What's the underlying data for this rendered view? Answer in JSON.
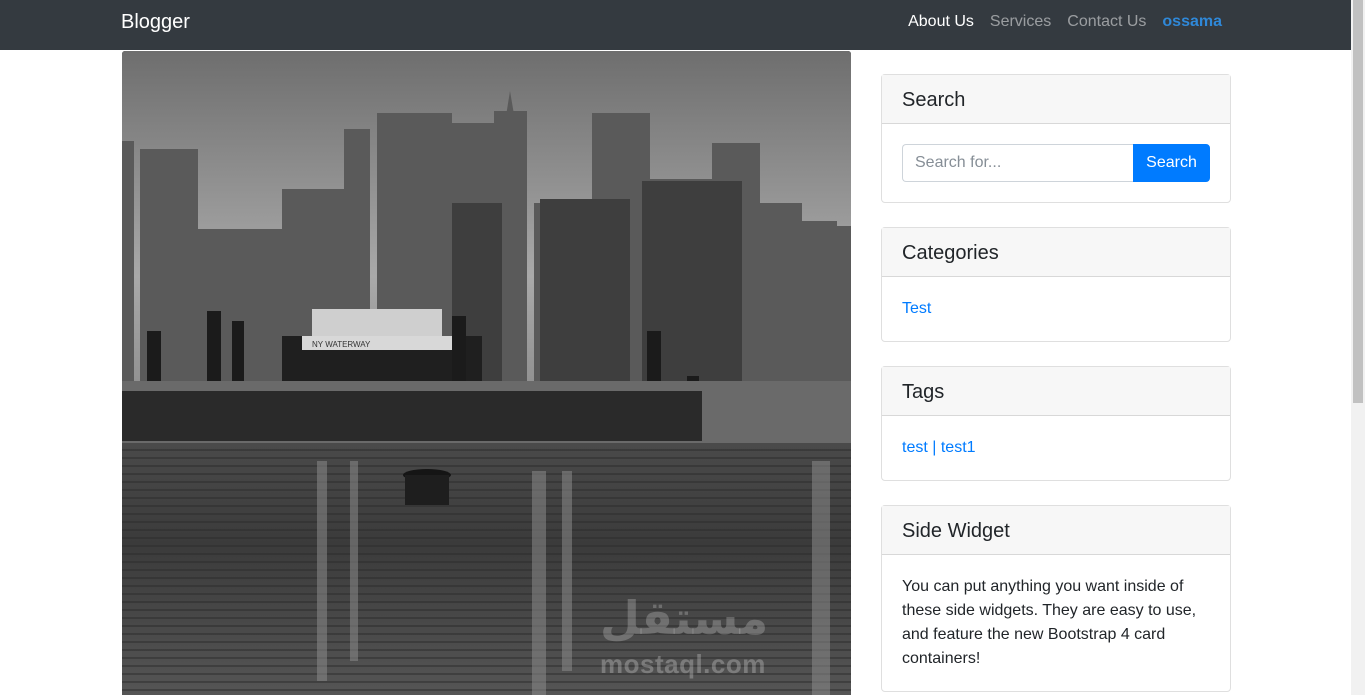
{
  "navbar": {
    "brand": "Blogger",
    "links": [
      "About Us",
      "Services",
      "Contact Us"
    ],
    "user": "ossama"
  },
  "hero": {
    "watermark_arabic": "مستقل",
    "watermark": "mostaql.com",
    "boat_label": "NY WATERWAY"
  },
  "sidebar": {
    "search": {
      "title": "Search",
      "placeholder": "Search for...",
      "button": "Search"
    },
    "categories": {
      "title": "Categories",
      "items": [
        "Test"
      ]
    },
    "tags": {
      "title": "Tags",
      "items": [
        "test",
        "test1"
      ],
      "separator": "|"
    },
    "side_widget": {
      "title": "Side Widget",
      "text": "You can put anything you want inside of these side widgets. They are easy to use, and feature the new Bootstrap 4 card containers!"
    }
  },
  "colors": {
    "navbar_bg": "#343a40",
    "primary": "#007bff",
    "user_link": "#2f88d8"
  }
}
